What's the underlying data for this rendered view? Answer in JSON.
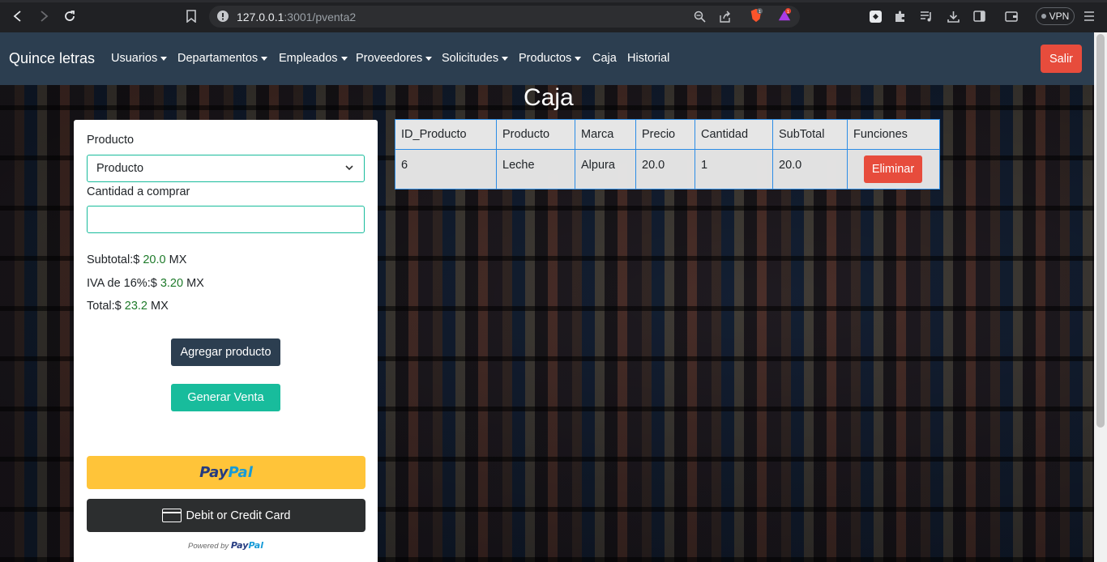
{
  "browser": {
    "url_host": "127.0.0.1",
    "url_path": ":3001/pventa2",
    "vpn_label": "VPN",
    "brave_badge": "1",
    "alert_badge": "1"
  },
  "navbar": {
    "brand": "Quince letras",
    "items": [
      {
        "label": "Usuarios"
      },
      {
        "label": "Departamentos"
      },
      {
        "label": "Empleados"
      },
      {
        "label": "Proveedores"
      },
      {
        "label": "Solicitudes"
      },
      {
        "label": "Productos"
      },
      {
        "label": "Caja"
      },
      {
        "label": "Historial"
      }
    ],
    "logout_label": "Salir"
  },
  "page": {
    "title": "Caja"
  },
  "form": {
    "product_label": "Producto",
    "product_selected": "Producto",
    "quantity_label": "Cantidad a comprar",
    "quantity_value": "",
    "subtotal_prefix": "Subtotal:$",
    "subtotal_value": "20.0",
    "iva_prefix": "IVA de 16%:$",
    "iva_value": "3.20",
    "total_prefix": "Total:$",
    "total_value": "23.2",
    "currency": "MX",
    "add_button": "Agregar producto",
    "sale_button": "Generar Venta"
  },
  "paypal": {
    "brand_pay": "Pay",
    "brand_pal": "Pal",
    "card_button": "Debit or Credit Card",
    "powered_by": "Powered by",
    "colors": {
      "button": "#ffc439",
      "dark": "#253b80",
      "light": "#179bd7"
    }
  },
  "table": {
    "headers": [
      "ID_Producto",
      "Producto",
      "Marca",
      "Precio",
      "Cantidad",
      "SubTotal",
      "Funciones"
    ],
    "rows": [
      {
        "id": "6",
        "product": "Leche",
        "brand": "Alpura",
        "price": "20.0",
        "qty": "1",
        "subtotal": "20.0",
        "action": "Eliminar"
      }
    ]
  },
  "colors": {
    "navbar": "#2c3e50",
    "danger": "#e74c3c",
    "success": "#18bc9c",
    "table_border": "#2b8ce6"
  }
}
